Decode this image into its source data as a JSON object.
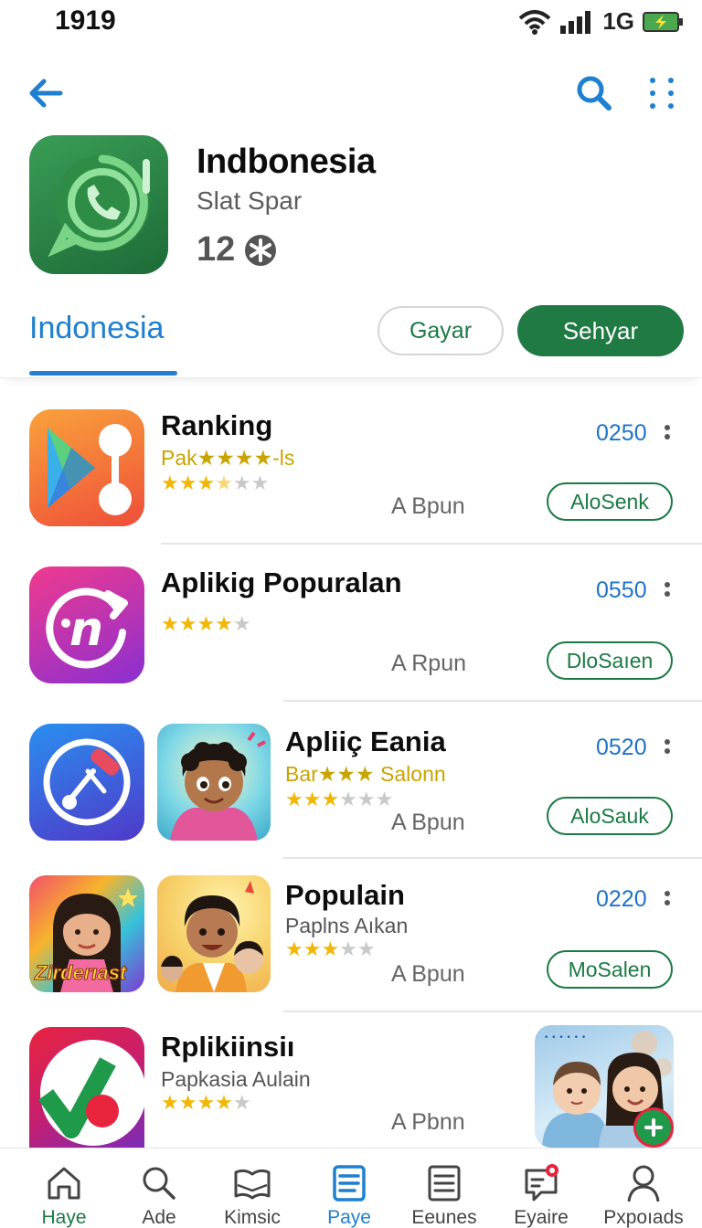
{
  "status": {
    "time": "1919",
    "network": "1G"
  },
  "header": {
    "title": "Indbonesia",
    "subtitle": "Slat Spar",
    "rating": "12"
  },
  "tabs": {
    "active_label": "Indonesia",
    "outline_button": "Gayar",
    "filled_button": "Sehyar"
  },
  "apps": [
    {
      "title": "Ranking",
      "subtitle": "Pak★★★★-ls",
      "stars": 3.5,
      "by": "A Bpun",
      "price": "0250",
      "action": "AloSenk"
    },
    {
      "title": "Aplikig Popuralan",
      "subtitle": "",
      "stars": 4,
      "by": "A Rpun",
      "price": "0550",
      "action": "DloSaıen"
    },
    {
      "title": "Apliiç Eania",
      "subtitle": "Bar★★★ Salonn",
      "stars": 3,
      "by": "A Bpun",
      "price": "0520",
      "action": "AloSauk"
    },
    {
      "title": "Populain",
      "subtitle": "Paplns Aıkan",
      "stars": 3,
      "by": "A Bpun",
      "price": "0220",
      "action": "MoSalen"
    },
    {
      "title": "Rplikiinsiı",
      "subtitle": "Papkasia Aulain",
      "stars": 4,
      "by": "A Pbnn"
    }
  ],
  "thumbnail_caption": "Zirderıast",
  "nav": [
    {
      "label": "Haye",
      "icon": "home-icon"
    },
    {
      "label": "Ade",
      "icon": "search-icon"
    },
    {
      "label": "Kimsic",
      "icon": "open-book-icon"
    },
    {
      "label": "Paye",
      "icon": "document-list-icon"
    },
    {
      "label": "Eeunes",
      "icon": "notes-icon"
    },
    {
      "label": "Eyaire",
      "icon": "notification-message-icon"
    },
    {
      "label": "Pxpoıads",
      "icon": "person-icon"
    }
  ],
  "colors": {
    "accent_blue": "#1f7fd1",
    "brand_green": "#1f7a43",
    "star": "#f2b705"
  }
}
